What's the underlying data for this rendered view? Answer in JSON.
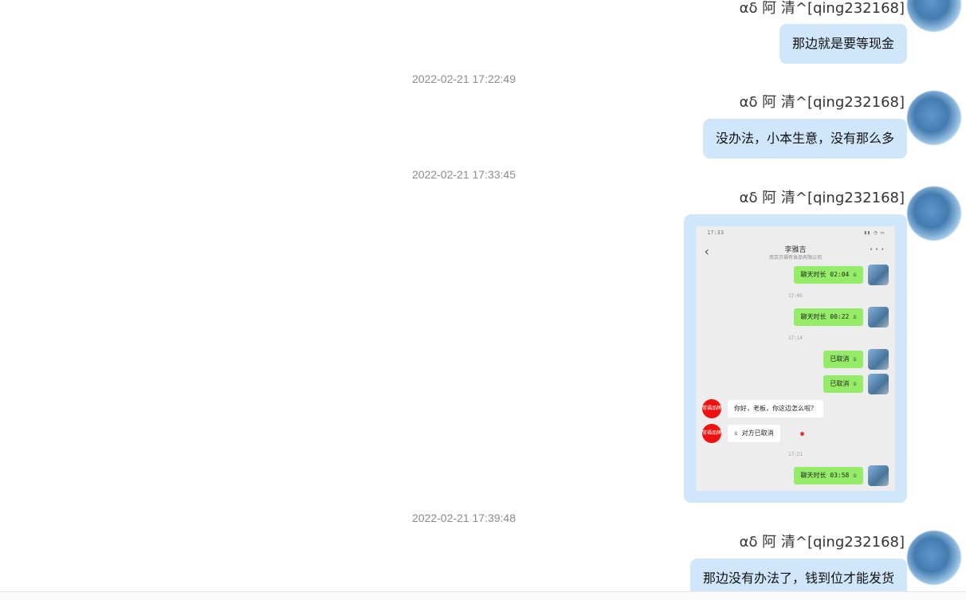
{
  "messages": [
    {
      "sender": "αδ 阿  清^[qing232168]",
      "text": "那边就是要等现金"
    },
    {
      "timestamp": "2022-02-21 17:22:49",
      "sender": "αδ 阿  清^[qing232168]",
      "text": "没办法，小本生意，没有那么多"
    },
    {
      "timestamp": "2022-02-21 17:33:45",
      "sender": "αδ 阿  清^[qing232168]",
      "image": "phone-chat-screenshot"
    },
    {
      "timestamp": "2022-02-21 17:39:48",
      "sender": "αδ 阿  清^[qing232168]",
      "text": "那边没有办法了，钱到位才能发货"
    }
  ],
  "screenshot": {
    "status_left": "17:33",
    "status_right": "▮▮ ◔ ▭",
    "contact_name": "李雅吉",
    "contact_sub": "南京贝福有食品有限公司",
    "bubbles": [
      {
        "text": "聊天时长 02:04 ☏"
      },
      {
        "time": "17:05"
      },
      {
        "text": "聊天时长 00:22 ☏"
      },
      {
        "time": "17:14"
      },
      {
        "text": "已取消 ☏"
      },
      {
        "text": "已取消 ☏"
      },
      {
        "text": "你好，老板，你这边怎么啦？",
        "incoming": true
      },
      {
        "text": "☏ 对方已取消",
        "incoming": true
      },
      {
        "time": "17:21"
      },
      {
        "text": "聊天时长 03:58 ☏"
      }
    ],
    "incoming_avatar_text": "常福品牌"
  },
  "icons": {
    "back": "‹",
    "more": "···"
  }
}
